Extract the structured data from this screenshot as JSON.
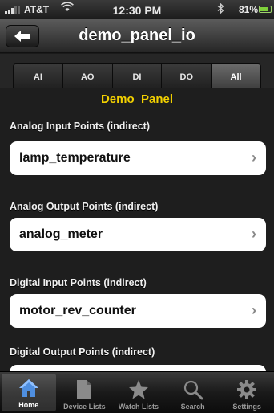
{
  "status_bar": {
    "carrier": "AT&T",
    "time": "12:30 PM",
    "battery_percent": "81%",
    "battery_level": 0.81
  },
  "nav": {
    "title": "demo_panel_io",
    "back_icon": "arrow-left-icon"
  },
  "filter_tabs": [
    {
      "label": "AI",
      "active": false
    },
    {
      "label": "AO",
      "active": false
    },
    {
      "label": "DI",
      "active": false
    },
    {
      "label": "DO",
      "active": false
    },
    {
      "label": "All",
      "active": true
    }
  ],
  "panel_title": "Demo_Panel",
  "sections": [
    {
      "header": "Analog Input Points (indirect)",
      "item": "lamp_temperature"
    },
    {
      "header": "Analog Output Points (indirect)",
      "item": "analog_meter"
    },
    {
      "header": "Digital Input Points (indirect)",
      "item": "motor_rev_counter"
    },
    {
      "header": "Digital Output Points (indirect)",
      "item": ""
    }
  ],
  "tab_bar": [
    {
      "label": "Home",
      "icon": "home-icon",
      "active": true
    },
    {
      "label": "Device Lists",
      "icon": "document-icon",
      "active": false
    },
    {
      "label": "Watch Lists",
      "icon": "star-icon",
      "active": false
    },
    {
      "label": "Search",
      "icon": "search-icon",
      "active": false
    },
    {
      "label": "Settings",
      "icon": "gear-icon",
      "active": false
    }
  ],
  "colors": {
    "panel_title": "#f2d000",
    "home_icon": "#4f8fe0"
  }
}
